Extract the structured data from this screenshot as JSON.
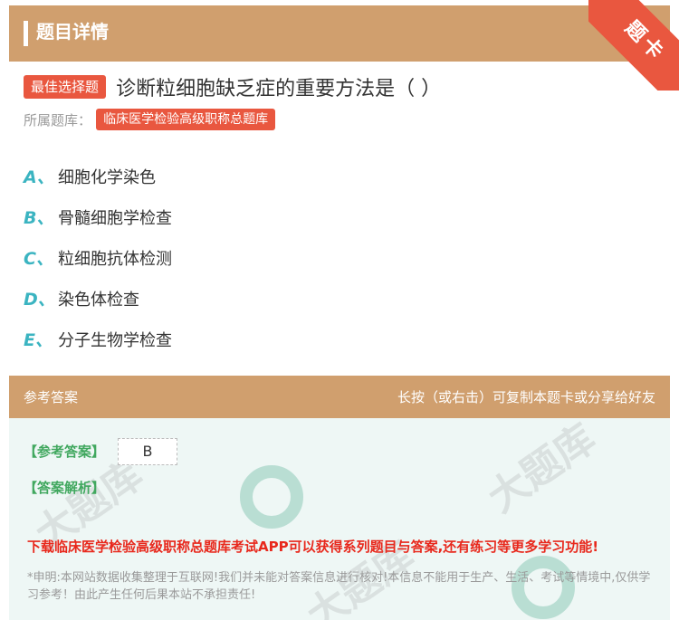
{
  "header": {
    "title": "题目详情"
  },
  "corner_badge": {
    "label": "题卡"
  },
  "question": {
    "type_tag": "最佳选择题",
    "text": "诊断粒细胞缺乏症的重要方法是（ ）",
    "bank_label": "所属题库：",
    "bank_name": "临床医学检验高级职称总题库"
  },
  "options": [
    {
      "letter": "A、",
      "text": "细胞化学染色"
    },
    {
      "letter": "B、",
      "text": "骨髓细胞学检查"
    },
    {
      "letter": "C、",
      "text": "粒细胞抗体检测"
    },
    {
      "letter": "D、",
      "text": "染色体检查"
    },
    {
      "letter": "E、",
      "text": "分子生物学检查"
    }
  ],
  "answer_section": {
    "title": "参考答案",
    "hint": "长按（或右击）可复制本题卡或分享给好友",
    "answer_label": "【参考答案】",
    "answer_value": "B",
    "analysis_label": "【答案解析】",
    "promo": "下载临床医学检验高级职称总题库考试APP可以获得系列题目与答案,还有练习等更多学习功能!",
    "disclaimer": "*申明:本网站数据收集整理于互联网!我们并未能对答案信息进行核对!本信息不能用于生产、生活、考试等情境中,仅供学习参考！由此产生任何后果本站不承担责任!"
  },
  "colors": {
    "header": "#d09f6e",
    "accent_red": "#e9573f",
    "option_letter": "#3bb4c1",
    "answer_green": "#41a85f",
    "promo_red": "#e8281c"
  }
}
